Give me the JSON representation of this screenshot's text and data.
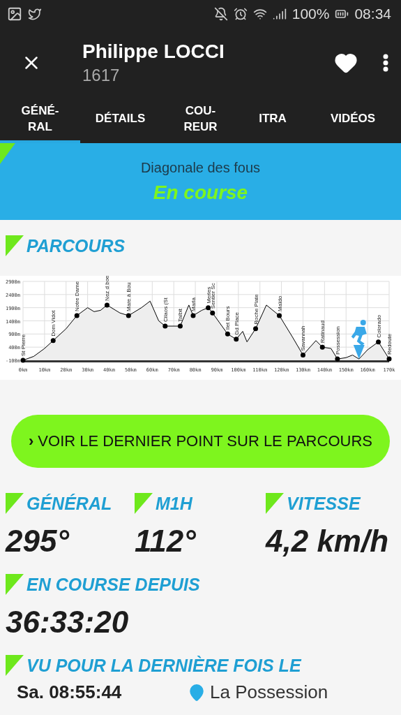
{
  "status_bar": {
    "battery": "100%",
    "time": "08:34"
  },
  "header": {
    "title": "Philippe LOCCI",
    "subtitle": "1617",
    "favorite": true
  },
  "tabs": [
    {
      "label": "GÉNÉ-\nRAL",
      "selected": true
    },
    {
      "label": "DÉTAILS",
      "selected": false
    },
    {
      "label": "COU-\nREUR",
      "selected": false
    },
    {
      "label": "ITRA",
      "selected": false
    },
    {
      "label": "VIDÉOS",
      "selected": false
    }
  ],
  "banner": {
    "race": "Diagonale des fous",
    "status": "En course"
  },
  "parcours": {
    "heading": "PARCOURS",
    "chart_data": {
      "type": "area",
      "x": [
        0,
        5,
        10,
        14,
        20,
        25,
        30,
        33,
        36,
        39,
        45,
        49,
        55,
        59,
        63,
        66,
        73,
        77,
        79,
        83,
        86,
        88,
        95,
        99,
        102,
        104,
        108,
        113,
        119,
        125,
        130,
        136,
        139,
        143,
        146,
        150,
        153,
        156,
        160,
        165,
        170
      ],
      "series": [
        {
          "color": "#000000",
          "values": [
            -100,
            50,
            350,
            650,
            1100,
            1600,
            1900,
            1750,
            1800,
            2000,
            1700,
            1600,
            1900,
            2150,
            1400,
            1200,
            1200,
            2000,
            1600,
            1800,
            1900,
            1700,
            900,
            700,
            1000,
            600,
            1100,
            2000,
            1600,
            800,
            100,
            650,
            400,
            350,
            -50,
            0,
            100,
            -50,
            300,
            600,
            -50
          ]
        }
      ],
      "grid": true,
      "xlim": [
        0,
        170
      ],
      "ylim": [
        -100,
        2900
      ],
      "xticks": [
        {
          "value": 0,
          "label": "0km"
        },
        {
          "value": 10,
          "label": "10km"
        },
        {
          "value": 20,
          "label": "20km"
        },
        {
          "value": 30,
          "label": "30km"
        },
        {
          "value": 40,
          "label": "40km"
        },
        {
          "value": 50,
          "label": "50km"
        },
        {
          "value": 60,
          "label": "60km"
        },
        {
          "value": 70,
          "label": "70km"
        },
        {
          "value": 80,
          "label": "80km"
        },
        {
          "value": 90,
          "label": "90km"
        },
        {
          "value": 100,
          "label": "100km"
        },
        {
          "value": 110,
          "label": "110km"
        },
        {
          "value": 120,
          "label": "120km"
        },
        {
          "value": 130,
          "label": "130km"
        },
        {
          "value": 140,
          "label": "140km"
        },
        {
          "value": 150,
          "label": "150km"
        },
        {
          "value": 160,
          "label": "160km"
        },
        {
          "value": 170,
          "label": "170k"
        }
      ],
      "yticks": [
        {
          "value": -100,
          "label": "-100m"
        },
        {
          "value": 400,
          "label": "400m"
        },
        {
          "value": 900,
          "label": "900m"
        },
        {
          "value": 1400,
          "label": "1400m"
        },
        {
          "value": 1900,
          "label": "1900m"
        },
        {
          "value": 2400,
          "label": "2400m"
        },
        {
          "value": 2900,
          "label": "2900m"
        }
      ],
      "annotations": [
        {
          "x": 0,
          "y": -100,
          "text": "St Pierre"
        },
        {
          "x": 14,
          "y": 650,
          "text": "Dom Vidot"
        },
        {
          "x": 25,
          "y": 1600,
          "text": "Notre Dame"
        },
        {
          "x": 39,
          "y": 2000,
          "text": "Nez d boe"
        },
        {
          "x": 49,
          "y": 1600,
          "text": "Mare à Bou"
        },
        {
          "x": 66,
          "y": 1200,
          "text": "Cilaos (St"
        },
        {
          "x": 73,
          "y": 1200,
          "text": "Taïbit"
        },
        {
          "x": 79,
          "y": 1600,
          "text": "Marla"
        },
        {
          "x": 86,
          "y": 1900,
          "text": "Merles"
        },
        {
          "x": 88,
          "y": 1700,
          "text": "Sentier Sc"
        },
        {
          "x": 95,
          "y": 900,
          "text": "Ilet Bours"
        },
        {
          "x": 99,
          "y": 700,
          "text": "Gd Place"
        },
        {
          "x": 108,
          "y": 1100,
          "text": "Roche Plate"
        },
        {
          "x": 119,
          "y": 1600,
          "text": "Maïdo"
        },
        {
          "x": 130,
          "y": 100,
          "text": "Savannah"
        },
        {
          "x": 139,
          "y": 400,
          "text": "Ratinaud"
        },
        {
          "x": 146,
          "y": -50,
          "text": "Possession"
        },
        {
          "x": 165,
          "y": 600,
          "text": "Colorado"
        },
        {
          "x": 170,
          "y": -50,
          "text": "Redoute"
        }
      ]
    }
  },
  "action_button": {
    "icon": "›",
    "label": "VOIR LE DERNIER POINT SUR LE PARCOURS"
  },
  "stats": [
    {
      "label": "GÉNÉRAL",
      "value": "295°"
    },
    {
      "label": "M1H",
      "value": "112°"
    },
    {
      "label": "VITESSE",
      "value": "4,2 km/h"
    }
  ],
  "running_since": {
    "label": "EN COURSE DEPUIS",
    "value": "36:33:20"
  },
  "last_seen": {
    "label": "VU POUR LA DERNIÈRE FOIS LE",
    "time": "Sa. 08:55:44",
    "place": "La Possession"
  }
}
